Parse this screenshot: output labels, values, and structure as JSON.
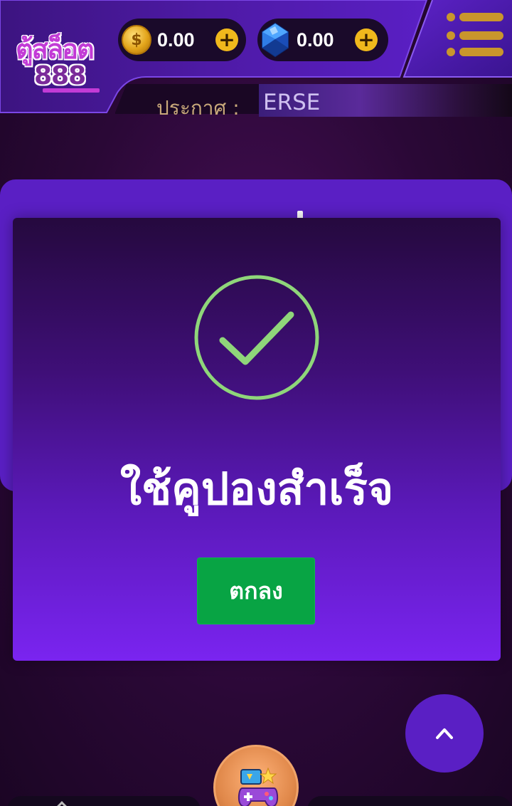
{
  "header": {
    "logo_text": "ตู้สล็อต",
    "logo_number": "888",
    "coin_balance": "0.00",
    "gem_balance": "0.00",
    "announcement_label": "ประกาศ :",
    "announcement_text": "ERSE",
    "menu_icon": "hamburger-menu-icon"
  },
  "modal": {
    "icon": "check-circle-icon",
    "title": "ใช้คูปองสำเร็จ",
    "ok_label": "ตกลง"
  },
  "floating": {
    "scroll_top_icon": "chevron-up-icon",
    "center_icon": "gamepad-icon"
  },
  "colors": {
    "primary_purple": "#5a1fc4",
    "success_green": "#08a444",
    "check_green": "#8fd67a",
    "gold": "#f0b81c"
  }
}
